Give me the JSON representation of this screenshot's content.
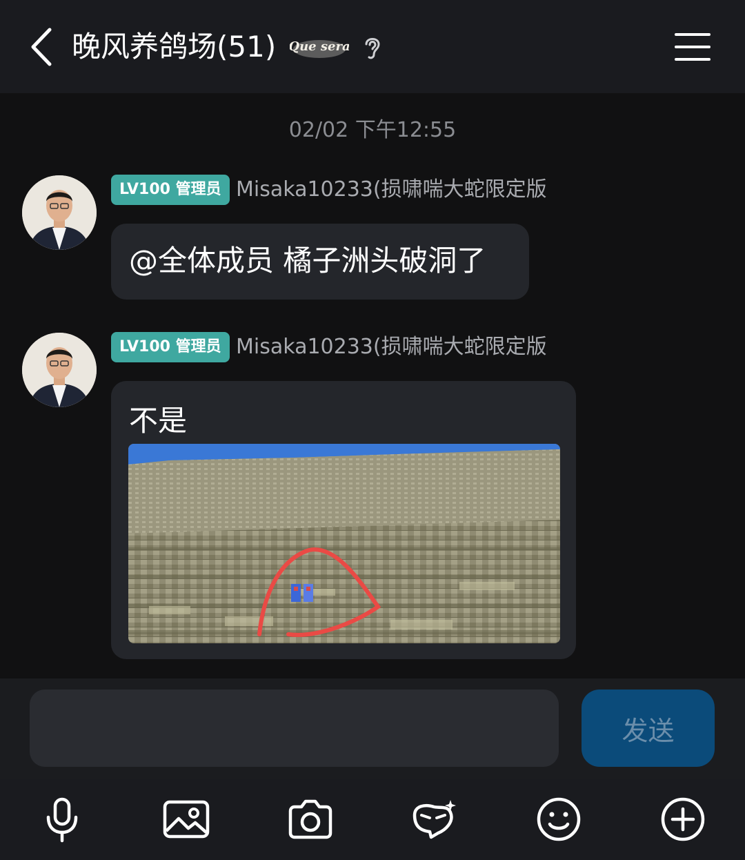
{
  "header": {
    "title": "晚风养鸽场(51)",
    "badge_text": "Que sera",
    "back_icon": "chevron-left-icon",
    "ear_icon": "ear-icon",
    "menu_icon": "hamburger-menu-icon"
  },
  "chat": {
    "timestamp": "02/02 下午12:55",
    "messages": [
      {
        "badge": "LV100 管理员",
        "sender": "Misaka10233(损啸喘大蛇限定版",
        "text": "@全体成员 橘子洲头破洞了"
      },
      {
        "badge": "LV100 管理员",
        "sender": "Misaka10233(损啸喘大蛇限定版",
        "text": "不是",
        "image": "minecraft-screenshot-with-red-circle"
      }
    ]
  },
  "input": {
    "placeholder": "",
    "value": "",
    "send_label": "发送"
  },
  "toolbar": {
    "icons": [
      "microphone-icon",
      "image-icon",
      "camera-icon",
      "sticker-icon",
      "emoji-icon",
      "plus-icon"
    ]
  },
  "colors": {
    "background": "#111112",
    "bubble": "#24262b",
    "badge": "#3fa8a0",
    "send_button": "#0b4b7a"
  }
}
